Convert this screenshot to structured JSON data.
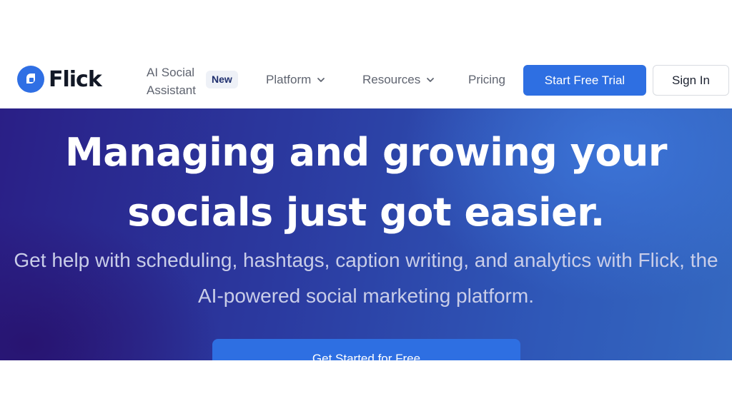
{
  "brand": {
    "name": "Flick",
    "color": "#2f6fe4"
  },
  "nav": {
    "ai_label": "AI Social Assistant",
    "new_badge": "New",
    "platform": "Platform",
    "resources": "Resources",
    "pricing": "Pricing",
    "start_trial": "Start Free Trial",
    "sign_in": "Sign In"
  },
  "hero": {
    "title": "Managing and growing your socials just got easier.",
    "subtitle": "Get help with scheduling, hashtags, caption writing, and analytics with Flick, the AI-powered social marketing platform.",
    "cta": "Get Started for Free"
  },
  "colors": {
    "accent": "#2e6fe2",
    "hero_gradient_start": "#2a1f86",
    "hero_gradient_end": "#3468c0"
  }
}
